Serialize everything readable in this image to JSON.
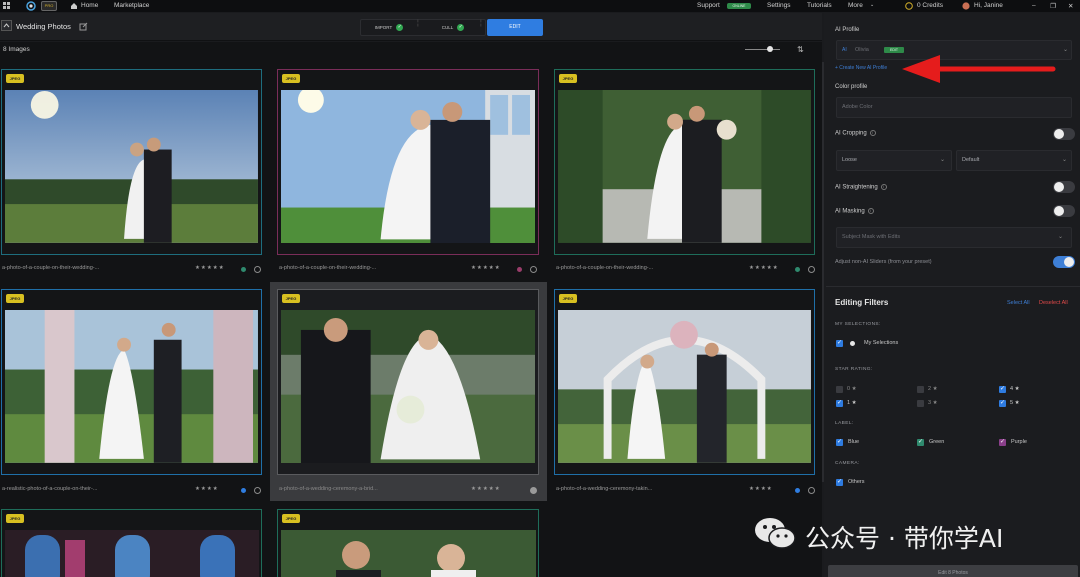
{
  "topbar": {
    "pro_badge": "PRO",
    "home": "Home",
    "marketplace": "Marketplace",
    "support": "Support",
    "online_badge": "ONLINE",
    "settings": "Settings",
    "tutorials": "Tutorials",
    "more": "More",
    "credits": "0 Credits",
    "user": "Hi, Janine"
  },
  "header": {
    "title": "Wedding Photos",
    "import": "IMPORT",
    "cull": "CULL",
    "edit": "EDIT",
    "count": "8 Images"
  },
  "cards": [
    {
      "jpeg": "JPEG",
      "name": "a-photo-of-a-couple-on-their-wedding-...",
      "stars": "★★★★★",
      "dot_color": "#2f8a6e",
      "border": "#1e6d7e"
    },
    {
      "jpeg": "JPEG",
      "name": "a-photo-of-a-couple-on-their-wedding-...",
      "stars": "★★★★★",
      "dot_color": "#9a3d6b",
      "border": "#7a2d59"
    },
    {
      "jpeg": "JPEG",
      "name": "a-photo-of-a-couple-on-their-wedding-...",
      "stars": "★★★★★",
      "dot_color": "#2f8a6e",
      "border": "#1e6d5a"
    },
    {
      "jpeg": "JPEG",
      "name": "a-realistic-photo-of-a-couple-on-their-...",
      "stars": "★★★★",
      "dot_color": "#2f7de1",
      "border": "#1f6fa8"
    },
    {
      "jpeg": "JPEG",
      "name": "a-photo-of-a-wedding-ceremony-a-brid...",
      "stars": "★★★★★",
      "dot_color": "#9a9a9a",
      "border": "#5a5b5e"
    },
    {
      "jpeg": "JPEG",
      "name": "a-photo-of-a-wedding-ceremony-takin...",
      "stars": "★★★★",
      "dot_color": "#2f7de1",
      "border": "#1f6fa8"
    },
    {
      "jpeg": "JPEG",
      "name": "",
      "stars": "",
      "dot_color": "",
      "border": "#1e6d5a"
    },
    {
      "jpeg": "JPEG",
      "name": "",
      "stars": "",
      "dot_color": "",
      "border": "#1e6d5a"
    }
  ],
  "panel": {
    "ai_profile": "AI Profile",
    "profile_value": "Olivia",
    "profile_tag": "EDIT",
    "create_profile": "+ Create New AI Profile",
    "color_profile": "Color profile",
    "color_value": "Adobe Color",
    "ai_cropping": "AI Cropping",
    "crop_a": "Loose",
    "crop_b": "Default",
    "ai_straightening": "AI Straightening",
    "ai_masking": "AI Masking",
    "mask_value": "Subject Mask with Edits",
    "adjust_sliders": "Adjust non-AI Sliders (from your preset)",
    "editing_filters": "Editing Filters",
    "select_all": "Select All",
    "deselect_all": "Deselect All",
    "my_selections_hdr": "MY SELECTIONS:",
    "my_selections": "My Selections",
    "star_rating_hdr": "STAR RATING:",
    "star_0": "0 ★",
    "star_1": "1 ★",
    "star_2": "2 ★",
    "star_3": "3 ★",
    "star_4": "4 ★",
    "star_5": "5 ★",
    "label_hdr": "LABEL:",
    "label_blue": "Blue",
    "label_green": "Green",
    "label_purple": "Purple",
    "camera_hdr": "CAMERA:",
    "camera_others": "Others",
    "edit_button": "Edit 8 Photos"
  },
  "watermark": "公众号 · 带你学AI"
}
